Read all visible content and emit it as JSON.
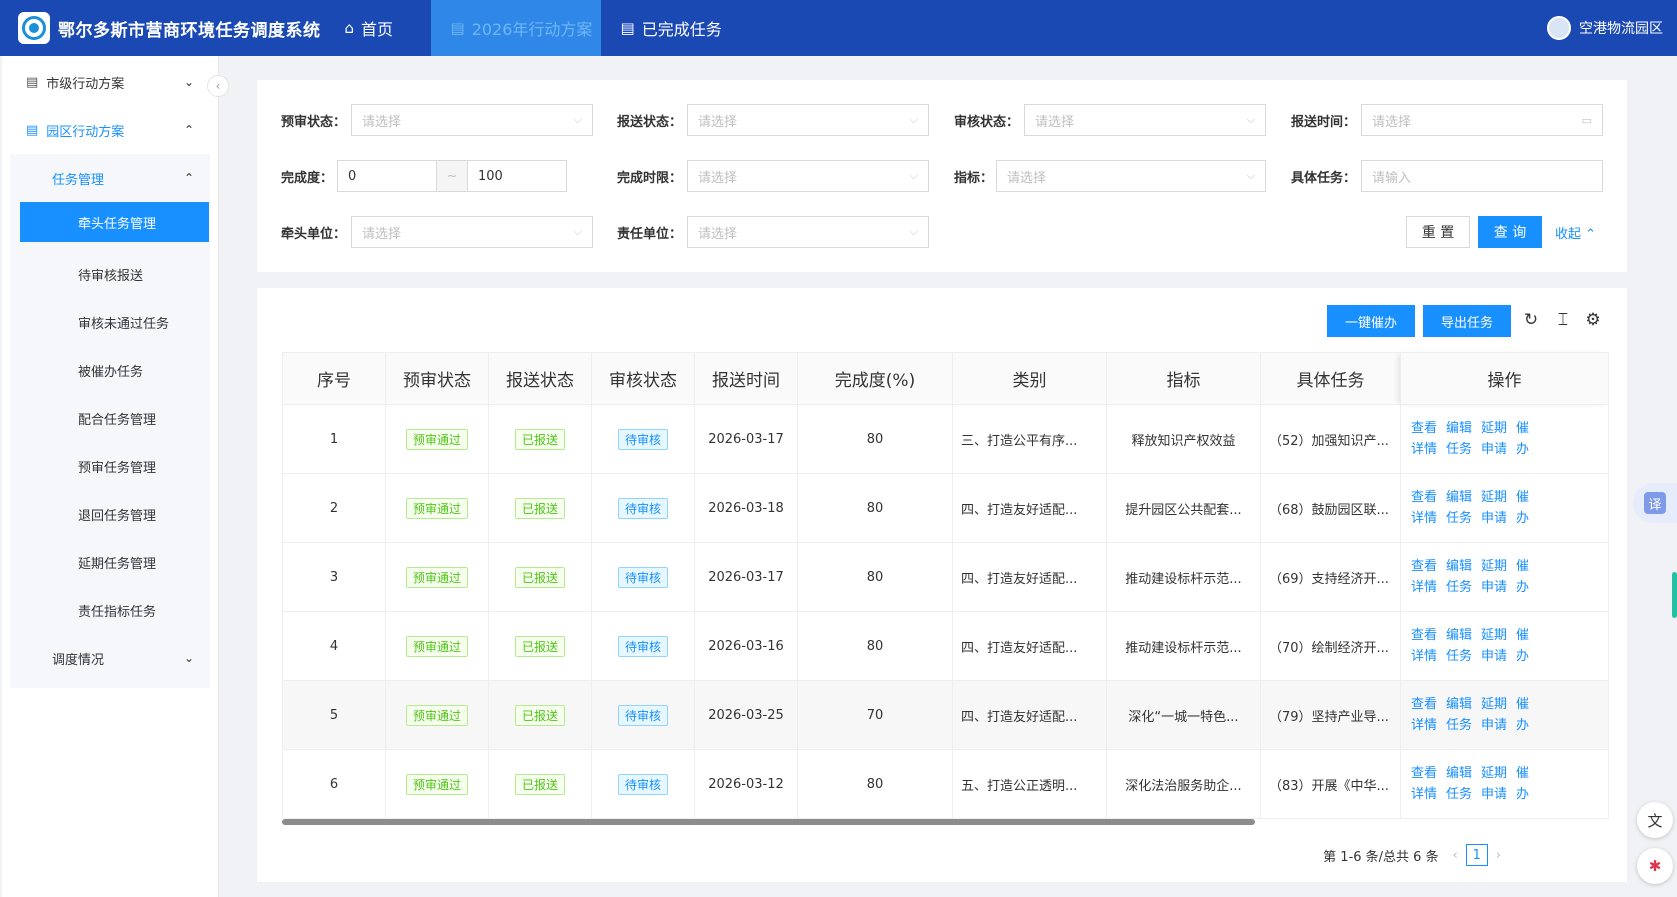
{
  "app": {
    "title": "鄂尔多斯市营商环境任务调度系统"
  },
  "nav": [
    {
      "label": "首页",
      "icon": "home-icon"
    },
    {
      "label": "2026年行动方案",
      "icon": "doc-icon"
    },
    {
      "label": "已完成任务",
      "icon": "doc-icon"
    }
  ],
  "user": {
    "name": "空港物流园区"
  },
  "sidebar": {
    "menu1": "市级行动方案",
    "menu2": "园区行动方案",
    "sub_head": "任务管理",
    "items": [
      "牵头任务管理",
      "待审核报送",
      "审核未通过任务",
      "被催办任务",
      "配合任务管理",
      "预审任务管理",
      "退回任务管理",
      "延期任务管理",
      "责任指标任务"
    ],
    "sub_foot": "调度情况"
  },
  "filter": {
    "pre_review_label": "预审状态：",
    "report_status_label": "报送状态：",
    "review_status_label": "审核状态：",
    "report_time_label": "报送时间：",
    "completion_label": "完成度：",
    "completion_min": "0",
    "completion_sep": "~",
    "completion_max": "100",
    "deadline_label": "完成时限：",
    "indicator_label": "指标：",
    "task_label": "具体任务：",
    "lead_unit_label": "牵头单位：",
    "resp_unit_label": "责任单位：",
    "select_placeholder": "请选择",
    "input_placeholder": "请输入",
    "reset_label": "重 置",
    "query_label": "查 询",
    "collapse_label": "收起"
  },
  "toolbar": {
    "urge_label": "一键催办",
    "export_label": "导出任务"
  },
  "table": {
    "headers": [
      "序号",
      "预审状态",
      "报送状态",
      "审核状态",
      "报送时间",
      "完成度(%)",
      "类别",
      "指标",
      "具体任务",
      "操作"
    ],
    "rows": [
      {
        "no": "1",
        "pre": "预审通过",
        "rep": "已报送",
        "rev": "待审核",
        "time": "2026-03-17",
        "pct": "80",
        "cat": "三、打造公平有序...",
        "ind": "释放知识产权效益",
        "task": "（52）加强知识产..."
      },
      {
        "no": "2",
        "pre": "预审通过",
        "rep": "已报送",
        "rev": "待审核",
        "time": "2026-03-18",
        "pct": "80",
        "cat": "四、打造友好适配...",
        "ind": "提升园区公共配套...",
        "task": "（68）鼓励园区联..."
      },
      {
        "no": "3",
        "pre": "预审通过",
        "rep": "已报送",
        "rev": "待审核",
        "time": "2026-03-17",
        "pct": "80",
        "cat": "四、打造友好适配...",
        "ind": "推动建设标杆示范...",
        "task": "（69）支持经济开..."
      },
      {
        "no": "4",
        "pre": "预审通过",
        "rep": "已报送",
        "rev": "待审核",
        "time": "2026-03-16",
        "pct": "80",
        "cat": "四、打造友好适配...",
        "ind": "推动建设标杆示范...",
        "task": "（70）绘制经济开..."
      },
      {
        "no": "5",
        "pre": "预审通过",
        "rep": "已报送",
        "rev": "待审核",
        "time": "2026-03-25",
        "pct": "70",
        "cat": "四、打造友好适配...",
        "ind": "深化“一城一特色...",
        "task": "（79）坚持产业导..."
      },
      {
        "no": "6",
        "pre": "预审通过",
        "rep": "已报送",
        "rev": "待审核",
        "time": "2026-03-12",
        "pct": "80",
        "cat": "五、打造公正透明...",
        "ind": "深化法治服务助企...",
        "task": "（83）开展《中华..."
      }
    ],
    "ops_top": [
      "查看",
      "编辑",
      "延期",
      "催"
    ],
    "ops_bottom": [
      "详情",
      "任务",
      "申请",
      "办"
    ]
  },
  "pager": {
    "summary": "第 1-6 条/总共 6 条",
    "current": "1"
  },
  "floaters": {
    "translate": "译"
  }
}
